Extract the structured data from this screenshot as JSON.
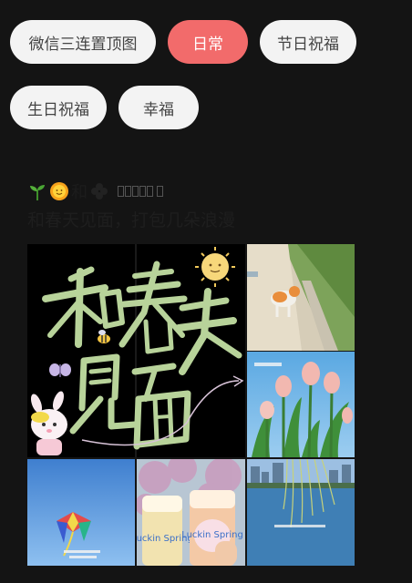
{
  "tabs": [
    {
      "label": "微信三连置顶图",
      "active": false
    },
    {
      "label": "日常",
      "active": true
    },
    {
      "label": "节日祝福",
      "active": false
    },
    {
      "label": "生日祝福",
      "active": false
    },
    {
      "label": "幸福",
      "active": false
    }
  ],
  "post": {
    "title_line1": "和",
    "title_line1_icons": [
      "sprout-emoji",
      "sun-emoji",
      "clover-emoji"
    ],
    "title_line2": "和春天见面，打包几朵浪漫"
  },
  "images": {
    "main": {
      "description_icon": "calligraphy-image",
      "text": "和春天见面"
    },
    "cup_labels": [
      "Luckin Spring",
      "Luckin Spring"
    ]
  },
  "colors": {
    "background": "#141414",
    "chip_bg": "#f3f3f3",
    "chip_active_bg": "#f26b6b",
    "calligraphy": "#b8d39a"
  }
}
